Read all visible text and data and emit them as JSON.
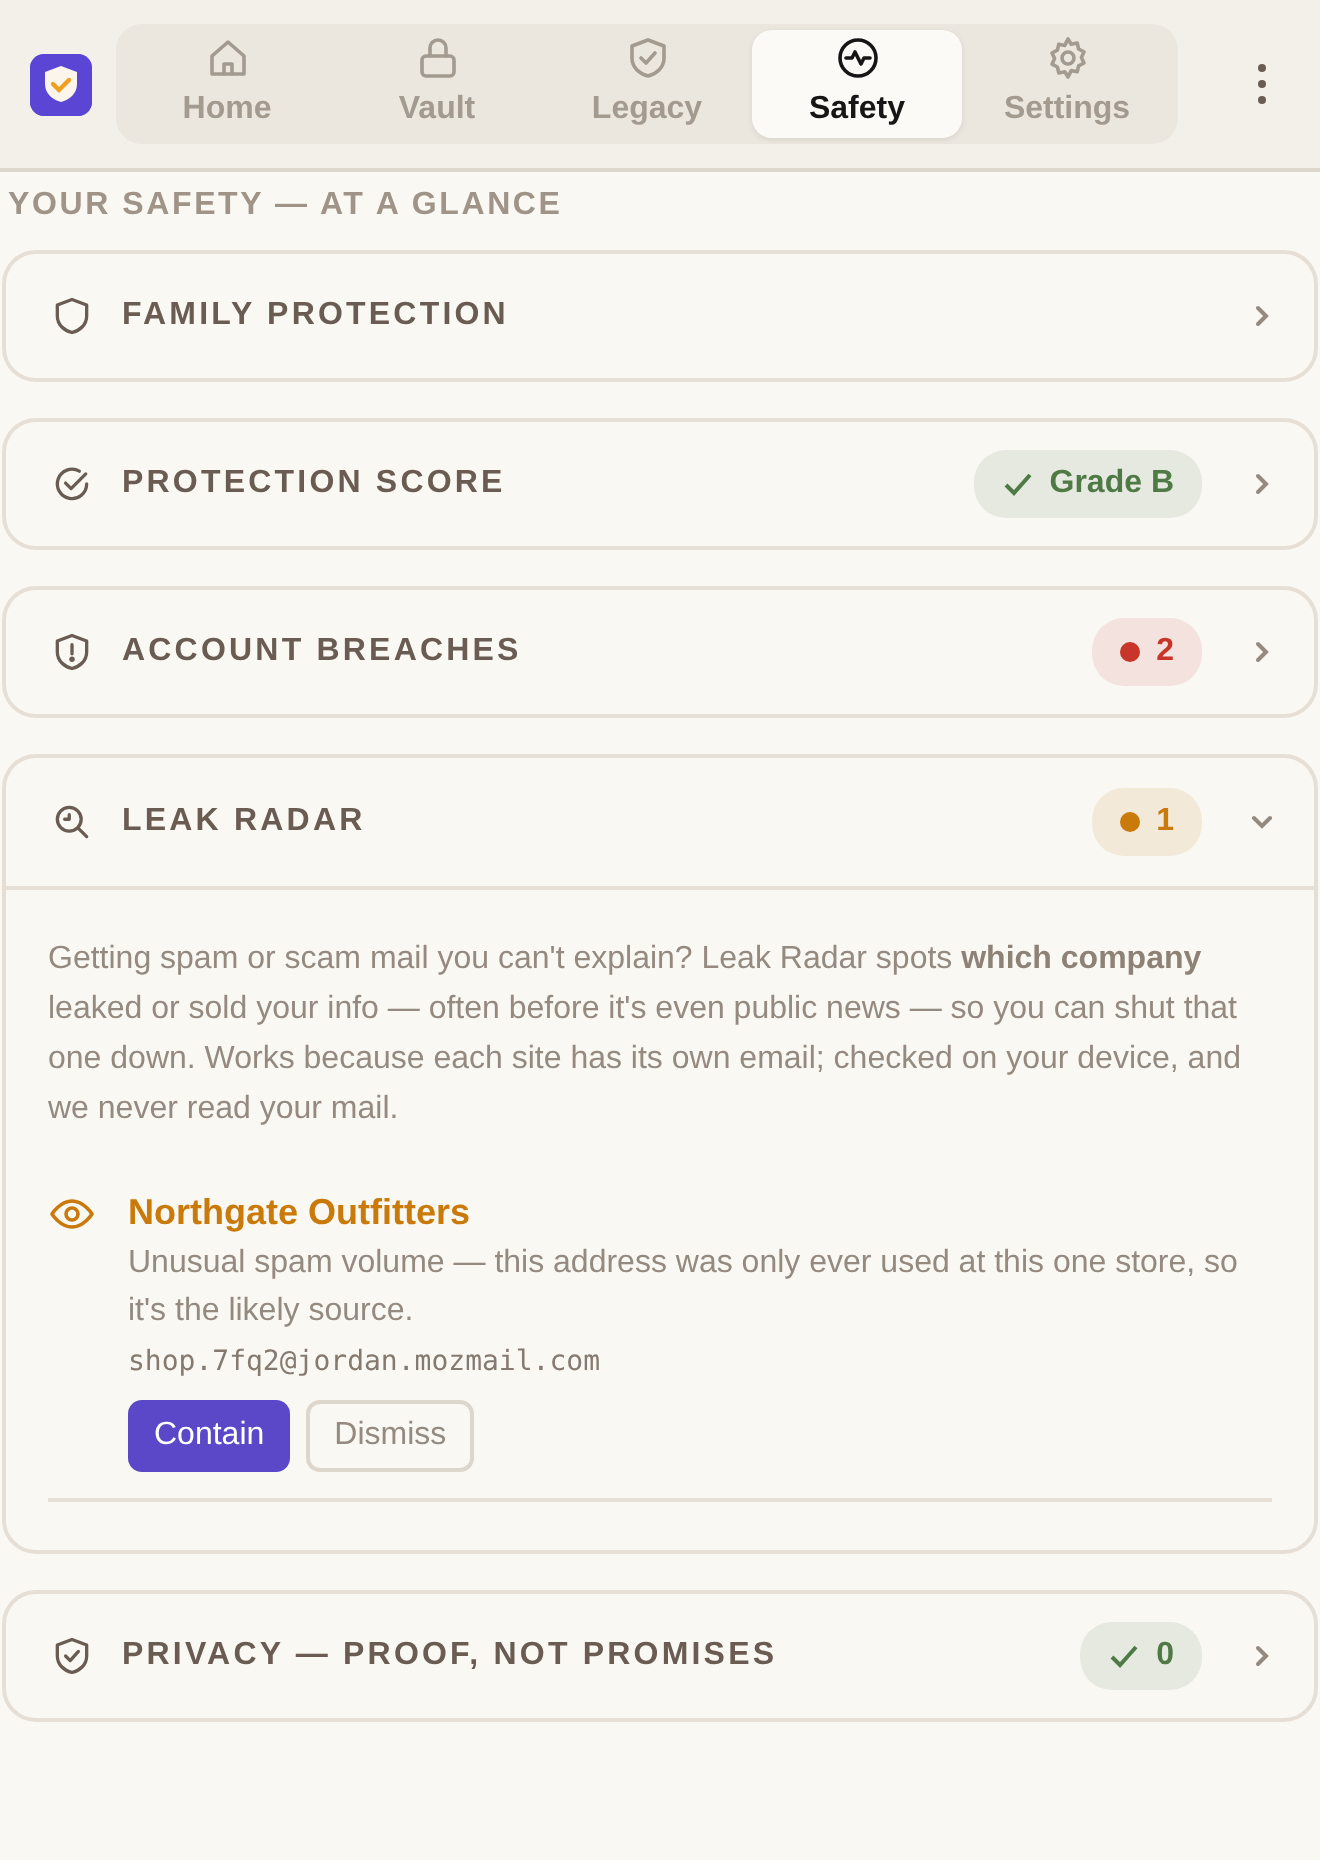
{
  "app": {
    "tabs": [
      {
        "label": "Home",
        "selected": false
      },
      {
        "label": "Vault",
        "selected": false
      },
      {
        "label": "Legacy",
        "selected": false
      },
      {
        "label": "Safety",
        "selected": true
      },
      {
        "label": "Settings",
        "selected": false
      }
    ]
  },
  "heading": "YOUR SAFETY — AT A GLANCE",
  "sections": [
    {
      "title": "FAMILY PROTECTION",
      "expanded": false
    },
    {
      "title": "PROTECTION SCORE",
      "expanded": false,
      "badge": {
        "kind": "check",
        "text": "Grade B",
        "color": "#4f7a45"
      }
    },
    {
      "title": "ACCOUNT BREACHES",
      "expanded": false,
      "badge": {
        "kind": "dot",
        "text": "2",
        "color": "#c8352b"
      }
    },
    {
      "title": "LEAK RADAR",
      "expanded": true,
      "badge": {
        "kind": "dot",
        "text": "1",
        "color": "#c97a0a"
      },
      "body": {
        "description": "Getting spam or scam mail you can't explain? Leak Radar spots **which company** leaked or sold your info — often before it's even public news — so you can shut that one down. Works because each site has its own email; checked on your device, and we never read your mail.",
        "alerts": [
          {
            "title": "Northgate Outfitters",
            "detail": "Unusual spam volume — this address was only ever used at this one store, so it's the likely source.",
            "address": "shop.7fq2@jordan.mozmail.com",
            "actions": [
              "Contain",
              "Dismiss"
            ]
          }
        ]
      }
    },
    {
      "title": "PRIVACY — PROOF, NOT PROMISES",
      "expanded": false,
      "badge": {
        "kind": "check",
        "text": "0",
        "color": "#4f7a45"
      }
    }
  ]
}
